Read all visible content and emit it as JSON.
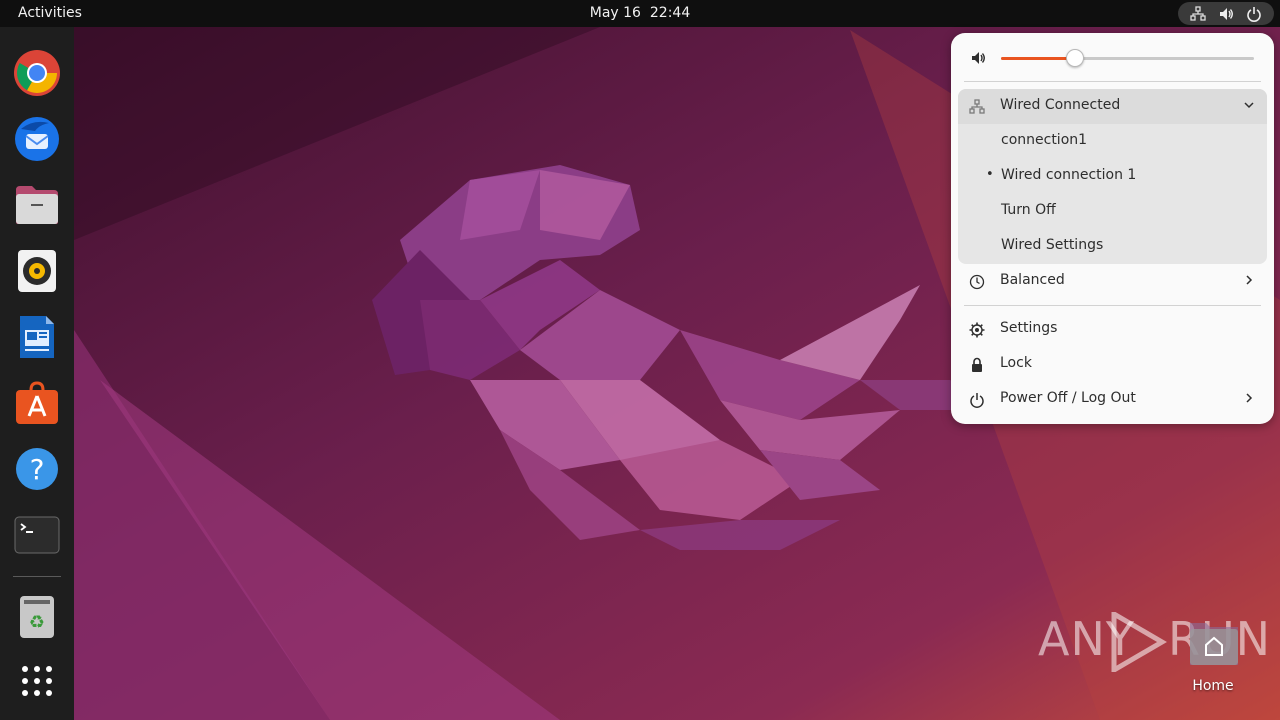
{
  "topbar": {
    "activities": "Activities",
    "date": "May 16",
    "time": "22:44",
    "tray_icons": [
      "network-wired-icon",
      "volume-icon",
      "power-icon"
    ]
  },
  "dock": {
    "items": [
      {
        "name": "chrome",
        "icon": "chrome-icon"
      },
      {
        "name": "thunderbird",
        "icon": "thunderbird-icon"
      },
      {
        "name": "files",
        "icon": "files-icon"
      },
      {
        "name": "rhythmbox",
        "icon": "rhythmbox-icon"
      },
      {
        "name": "libreoffice-writer",
        "icon": "writer-icon"
      },
      {
        "name": "app-center",
        "icon": "app-center-icon"
      },
      {
        "name": "help",
        "icon": "help-icon"
      },
      {
        "name": "terminal",
        "icon": "terminal-icon"
      },
      {
        "name": "trash",
        "icon": "trash-icon"
      },
      {
        "name": "show-apps",
        "icon": "app-grid-icon"
      }
    ]
  },
  "quick_settings": {
    "volume": {
      "icon": "volume-icon",
      "level": 0.29
    },
    "network": {
      "header": "Wired Connected",
      "items": [
        "connection1",
        "Wired connection 1",
        "Turn Off",
        "Wired Settings"
      ],
      "active_index": 1
    },
    "power_mode": {
      "label": "Balanced",
      "icon": "power-profile-icon"
    },
    "actions": [
      {
        "label": "Settings",
        "icon": "gear-icon"
      },
      {
        "label": "Lock",
        "icon": "lock-icon"
      },
      {
        "label": "Power Off / Log Out",
        "icon": "power-icon"
      }
    ]
  },
  "desktop": {
    "home_label": "Home"
  },
  "watermark": {
    "left": "ANY",
    "right": "RUN"
  },
  "colors": {
    "accent": "#e95420",
    "panel_bg": "#fafafa",
    "topbar_bg": "#0f0f0f",
    "dock_bg": "#1e1e1e"
  }
}
